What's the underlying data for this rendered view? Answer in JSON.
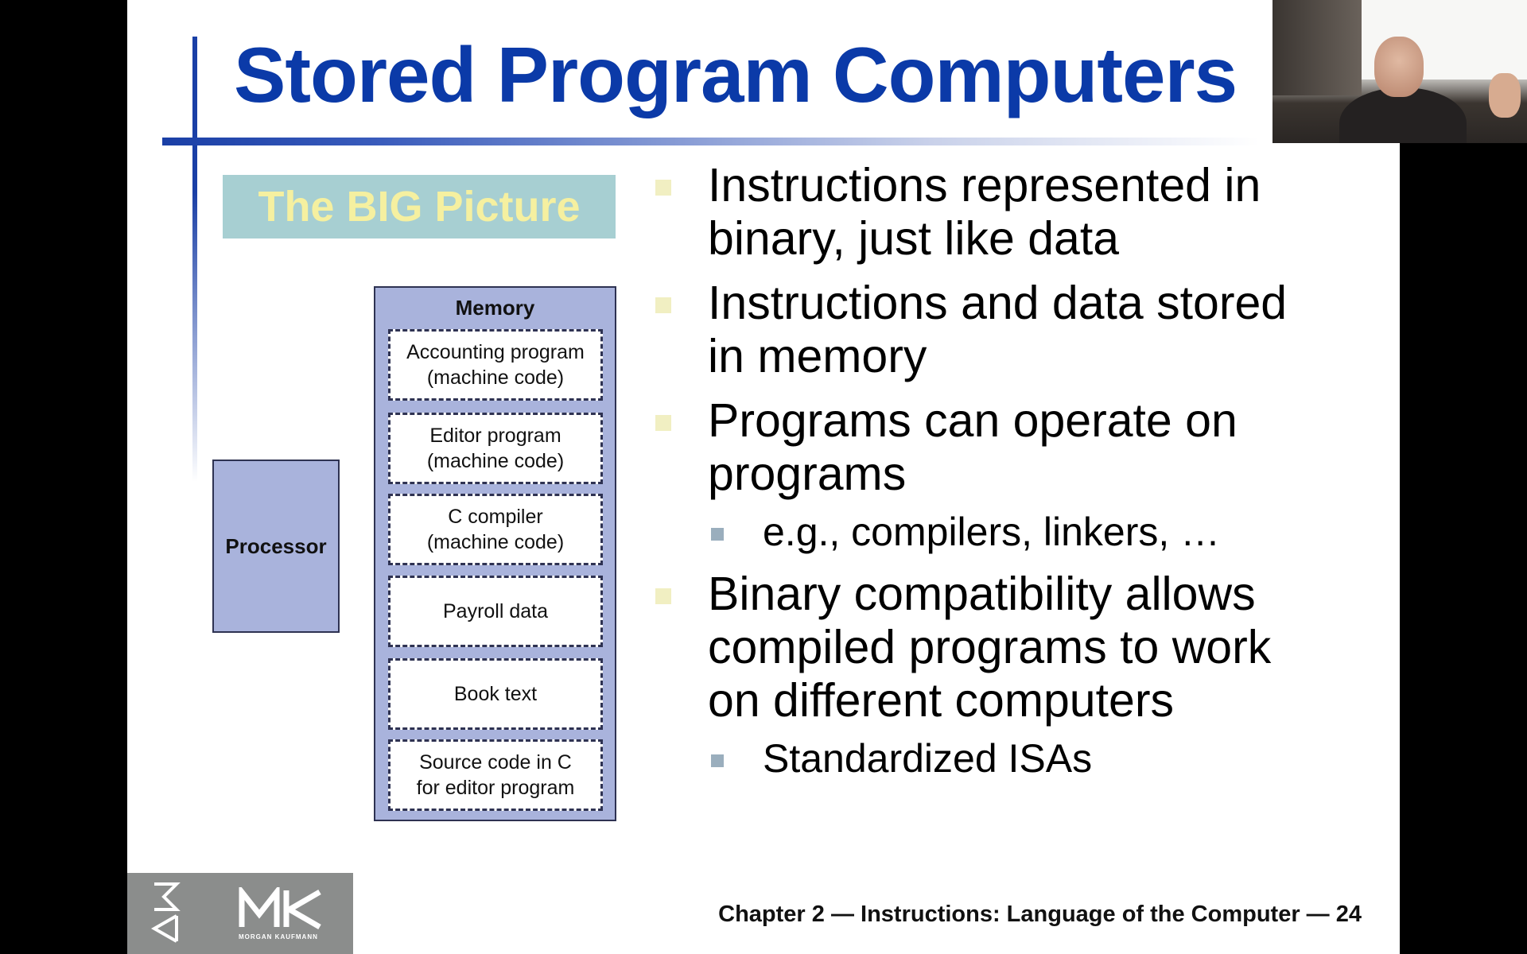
{
  "slide": {
    "title": "Stored Program Computers",
    "big_picture_label": "The BIG Picture",
    "diagram": {
      "processor_label": "Processor",
      "memory_label": "Memory",
      "memory_blocks": [
        "Accounting program\n(machine code)",
        "Editor program\n(machine code)",
        "C compiler\n(machine code)",
        "Payroll data",
        "Book text",
        "Source code in C\nfor editor program"
      ]
    },
    "bullets": [
      "Instructions represented in binary, just like data",
      "Instructions and data stored in memory",
      "Programs can operate on programs",
      "Binary compatibility allows compiled programs to work on different computers"
    ],
    "sub_bullets": [
      "e.g., compilers, linkers, …",
      "Standardized ISAs"
    ],
    "footer": "Chapter 2 — Instructions: Language of the Computer — 24",
    "publisher_logo": "MK",
    "publisher_name": "MORGAN KAUFMANN"
  },
  "colors": {
    "title": "#0b3aa8",
    "big_picture_bg": "#a7cfd2",
    "big_picture_text": "#f5f0a0",
    "diagram_fill": "#a9b3dc",
    "bullet_marker": "#f1efc2",
    "sub_bullet_marker": "#9aaebd",
    "logo_bg": "#8b8d8c"
  }
}
